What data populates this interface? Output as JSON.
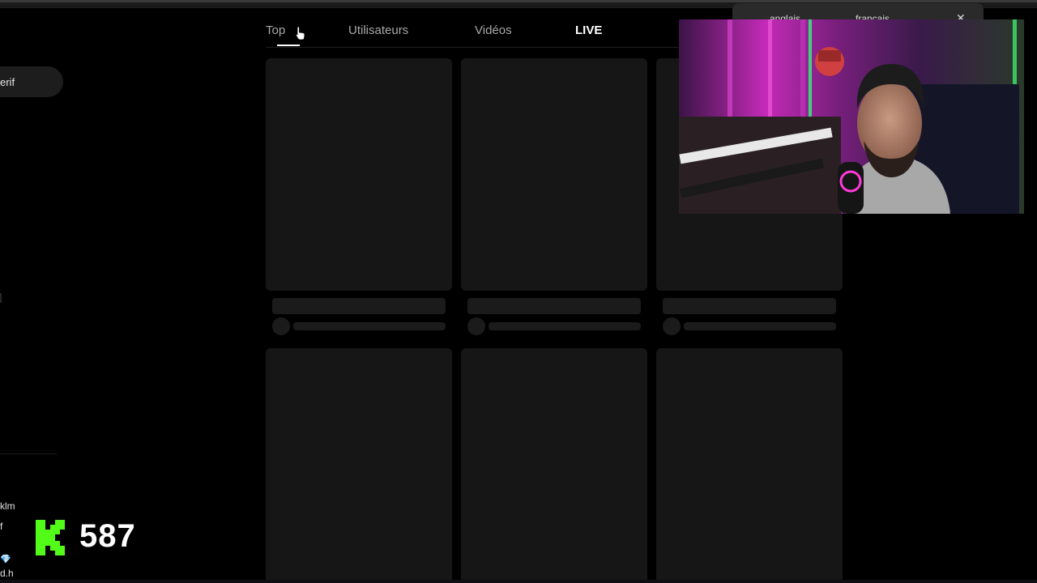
{
  "sidebar": {
    "pill_label": "erif",
    "chat_lines": [
      "klm",
      "f",
      "d.h"
    ],
    "k_count": "587",
    "k_letter": "K"
  },
  "tabs": [
    {
      "label": "Top",
      "active": false
    },
    {
      "label": "Utilisateurs",
      "active": false
    },
    {
      "label": "Vidéos",
      "active": false
    },
    {
      "label": "LIVE",
      "active": true
    }
  ],
  "translate": {
    "from": "anglais",
    "to": "français"
  },
  "colors": {
    "background": "#000000",
    "card": "#161616",
    "kick_green": "#53fc18",
    "text_muted": "#a8a8a8"
  }
}
